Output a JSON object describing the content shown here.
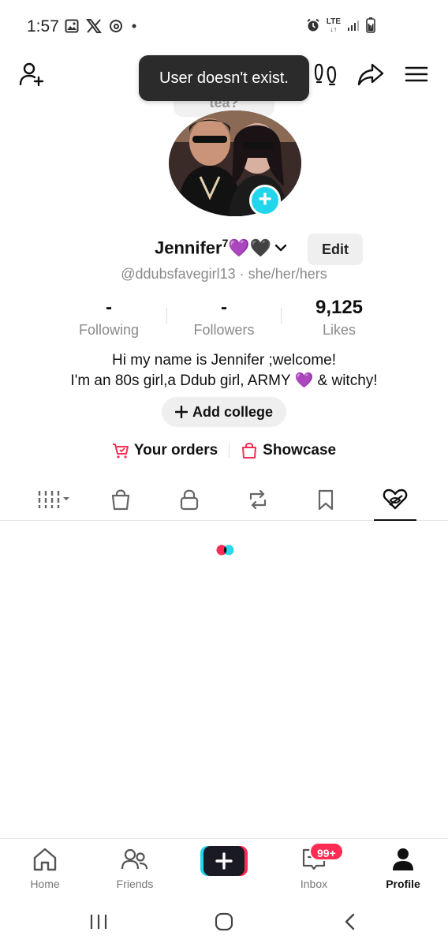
{
  "status_bar": {
    "time": "1:57",
    "network": "LTE"
  },
  "toast": {
    "message": "User doesn't exist."
  },
  "note_bubble": {
    "text": "tea?"
  },
  "profile": {
    "display_name": "Jennifer",
    "name_superscript": "7",
    "name_emoji": "💜🖤",
    "handle": "@ddubsfavegirl13",
    "pronouns": "she/her/hers",
    "handle_separator": "·",
    "edit_label": "Edit"
  },
  "stats": [
    {
      "value": "-",
      "label": "Following"
    },
    {
      "value": "-",
      "label": "Followers"
    },
    {
      "value": "9,125",
      "label": "Likes"
    }
  ],
  "bio": {
    "line1": "Hi my name is Jennifer ;welcome!",
    "line2": "I'm an 80s girl,a Ddub girl, ARMY 💜 & witchy!"
  },
  "college_button": {
    "label": "Add college",
    "icon": "plus-icon"
  },
  "shop_links": {
    "orders": "Your orders",
    "showcase": "Showcase"
  },
  "content_tabs": [
    "videos-grid-icon",
    "shopping-bag-icon",
    "lock-icon",
    "repost-icon",
    "bookmark-icon",
    "liked-hidden-icon"
  ],
  "bottom_nav": {
    "items": [
      {
        "label": "Home"
      },
      {
        "label": "Friends"
      },
      {
        "label": "Inbox",
        "badge": "99+"
      },
      {
        "label": "Profile"
      }
    ]
  },
  "colors": {
    "accent_pink": "#fe2c55",
    "accent_cyan": "#20d5ec",
    "toast_bg": "#2b2b2b"
  }
}
